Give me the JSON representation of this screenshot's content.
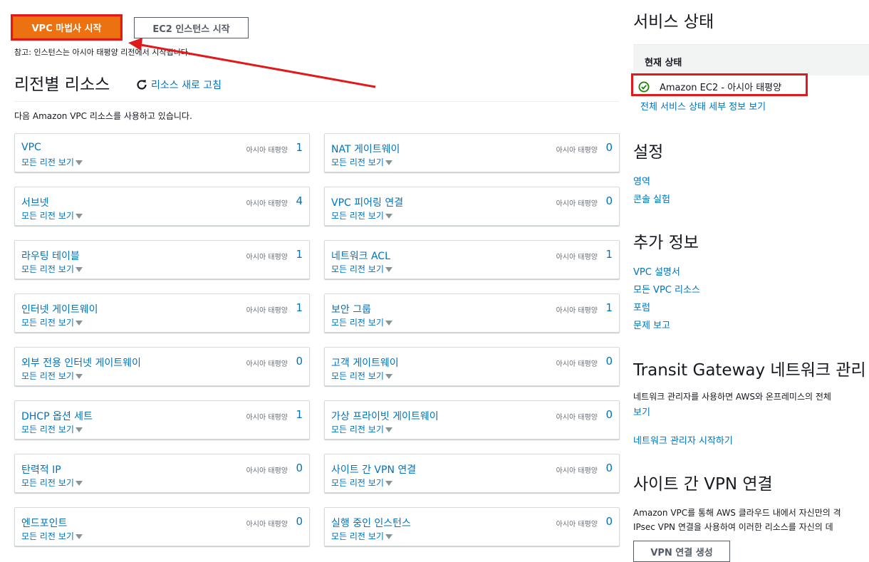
{
  "top": {
    "vpc_wizard_label": "VPC 마법사 시작",
    "ec2_launch_label": "EC2 인스턴스 시작",
    "note": "참고: 인스턴스는 아시아 태평양 리전에서 시작됩니다."
  },
  "resources": {
    "heading": "리전별 리소스",
    "refresh_label": "리소스 새로 고침",
    "subtitle": "다음 Amazon VPC 리소스를 사용하고 있습니다.",
    "see_all_label": "모든 리전 보기",
    "cards": [
      {
        "title": "VPC",
        "region": "아시아 태평양",
        "count": "1"
      },
      {
        "title": "NAT 게이트웨이",
        "region": "아시아 태평양",
        "count": "0"
      },
      {
        "title": "서브넷",
        "region": "아시아 태평양",
        "count": "4"
      },
      {
        "title": "VPC 피어링 연결",
        "region": "아시아 태평양",
        "count": "0"
      },
      {
        "title": "라우팅 테이블",
        "region": "아시아 태평양",
        "count": "1"
      },
      {
        "title": "네트워크 ACL",
        "region": "아시아 태평양",
        "count": "1"
      },
      {
        "title": "인터넷 게이트웨이",
        "region": "아시아 태평양",
        "count": "1"
      },
      {
        "title": "보안 그룹",
        "region": "아시아 태평양",
        "count": "1"
      },
      {
        "title": "외부 전용 인터넷 게이트웨이",
        "region": "아시아 태평양",
        "count": "0"
      },
      {
        "title": "고객 게이트웨이",
        "region": "아시아 태평양",
        "count": "0"
      },
      {
        "title": "DHCP 옵션 세트",
        "region": "아시아 태평양",
        "count": "1"
      },
      {
        "title": "가상 프라이빗 게이트웨이",
        "region": "아시아 태평양",
        "count": "0"
      },
      {
        "title": "탄력적 IP",
        "region": "아시아 태평양",
        "count": "0"
      },
      {
        "title": "사이트 간 VPN 연결",
        "region": "아시아 태평양",
        "count": "0"
      },
      {
        "title": "엔드포인트",
        "region": "아시아 태평양",
        "count": "0"
      },
      {
        "title": "실행 중인 인스턴스",
        "region": "아시아 태평양",
        "count": "0"
      }
    ]
  },
  "service_status": {
    "heading": "서비스 상태",
    "table_header": "현재 상태",
    "row_text": "Amazon EC2 - 아시아 태평양",
    "details_link": "전체 서비스 상태 세부 정보 보기"
  },
  "settings": {
    "heading": "설정",
    "links": [
      "영역",
      "콘솔 실험"
    ]
  },
  "additional_info": {
    "heading": "추가 정보",
    "links": [
      "VPC 설명서",
      "모든 VPC 리소스",
      "포럼",
      "문제 보고"
    ]
  },
  "transit_gateway": {
    "heading": "Transit Gateway 네트워크 관리",
    "desc": "네트워크 관리자를 사용하면 AWS와 온프레미스의 전체",
    "desc_link": "보기",
    "start_link": "네트워크 관리자 시작하기"
  },
  "site_vpn": {
    "heading": "사이트 간 VPN 연결",
    "desc_line1": "Amazon VPC를 통해 AWS 클라우드 내에서 자신만의 격",
    "desc_line2": "IPsec VPN 연결을 사용하여 이러한 리소스를 자신의 데",
    "create_button": "VPN 연결 생성"
  },
  "colors": {
    "primary_button": "#ec7211",
    "link": "#0073bb",
    "highlight": "#e0191b",
    "status_ok": "#1d8102"
  }
}
